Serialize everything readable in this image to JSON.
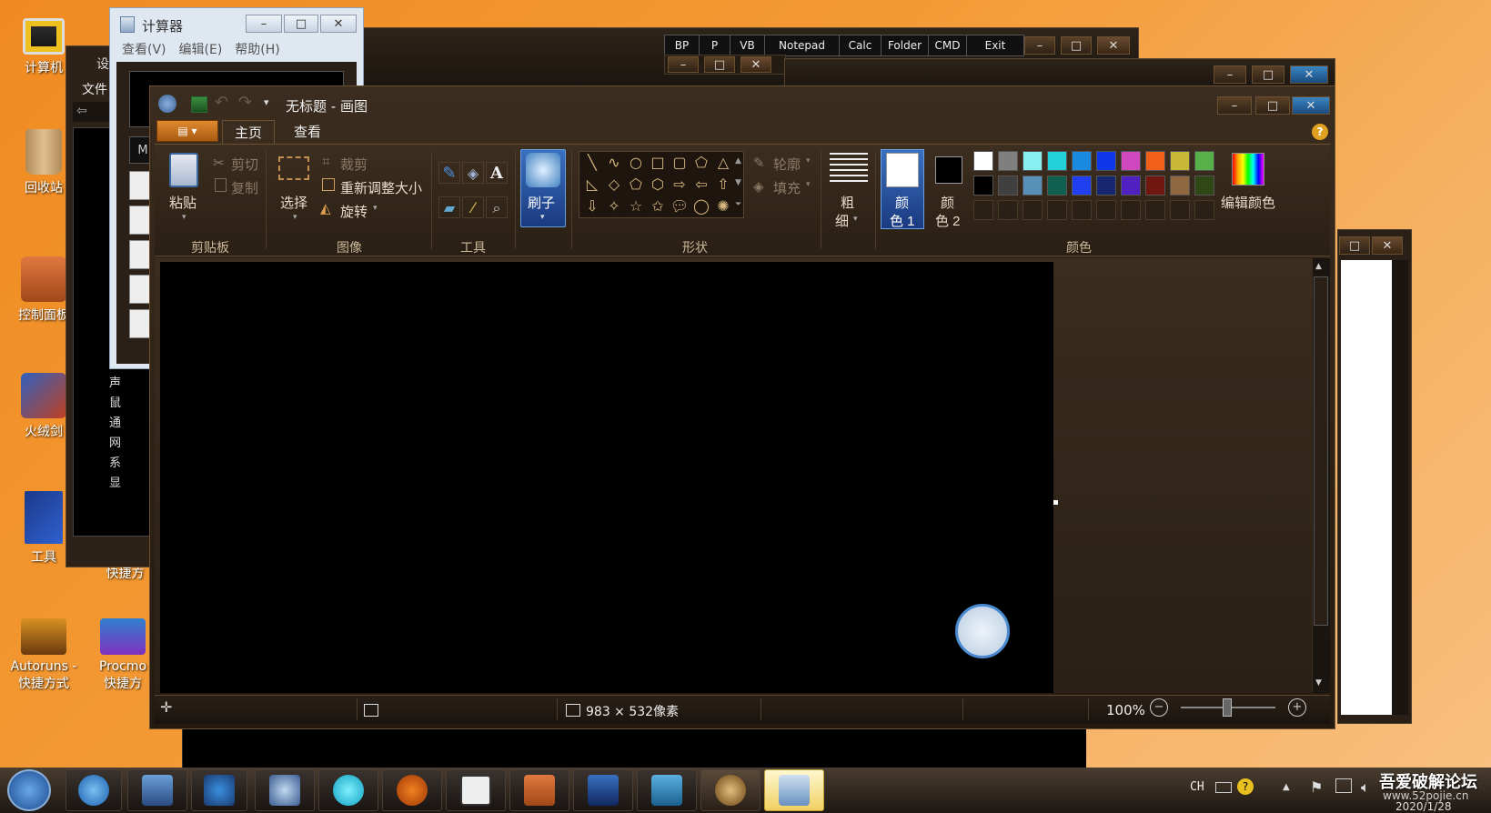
{
  "desktop": {
    "icons": [
      {
        "label": "计算机",
        "name": "computer"
      },
      {
        "label": "回收站",
        "name": "recycle-bin"
      },
      {
        "label": "控制面板",
        "name": "control-panel"
      },
      {
        "label": "火绒剑",
        "name": "huorongjian"
      },
      {
        "label": "工具",
        "name": "tools"
      },
      {
        "label": "Autoruns - 快捷方式",
        "name": "autoruns-shortcut"
      },
      {
        "label": "Procmo 快捷方",
        "name": "procmon-shortcut"
      },
      {
        "label": "快捷方",
        "name": "shortcut-partial"
      }
    ]
  },
  "launcher": {
    "buttons": [
      "BP",
      "P",
      "VB",
      "Notepad",
      "Calc",
      "Folder",
      "CMD",
      "Exit"
    ]
  },
  "calculator": {
    "title": "计算器",
    "menu": [
      "查看(V)",
      "编辑(E)",
      "帮助(H)"
    ]
  },
  "explorer": {
    "title_partial": "设",
    "menu_partial": "文件",
    "side_letters": [
      "M"
    ],
    "tree_labels": [
      "声",
      "鼠",
      "通",
      "网",
      "系",
      "显"
    ]
  },
  "paint": {
    "title": "无标题 - 画图",
    "tabs": [
      "主页",
      "查看"
    ],
    "clipboard": {
      "paste": "粘贴",
      "cut": "剪切",
      "copy": "复制",
      "group": "剪贴板"
    },
    "image": {
      "select": "选择",
      "crop": "裁剪",
      "resize": "重新调整大小",
      "rotate": "旋转",
      "group": "图像"
    },
    "tools": {
      "group": "工具"
    },
    "brush": {
      "label": "刷子"
    },
    "shapes": {
      "outline": "轮廓",
      "fill": "填充",
      "group": "形状"
    },
    "size": {
      "label1": "粗",
      "label2": "细"
    },
    "color1": {
      "label1": "颜",
      "label2": "色 1"
    },
    "color2": {
      "label1": "颜",
      "label2": "色 2"
    },
    "edit_colors": "编辑颜色",
    "colors_group": "颜色",
    "palette_row1": [
      "#ffffff",
      "#7f7f7f",
      "#88f0f0",
      "#22d0d8",
      "#1a8ae0",
      "#1038e8",
      "#d048c0",
      "#f06018",
      "#c8b838",
      "#58b048"
    ],
    "palette_row2": [
      "#000000",
      "#404040",
      "#5890b8",
      "#106050",
      "#2040f0",
      "#182870",
      "#5020c0",
      "#701810",
      "#906840",
      "#304818"
    ],
    "status": {
      "dimensions": "983 × 532像素",
      "zoom": "100%"
    }
  },
  "taskbar": {
    "tray_lang": "CH",
    "watermark": "吾爱破解论坛",
    "url": "www.52pojie.cn",
    "date": "2020/1/28"
  }
}
